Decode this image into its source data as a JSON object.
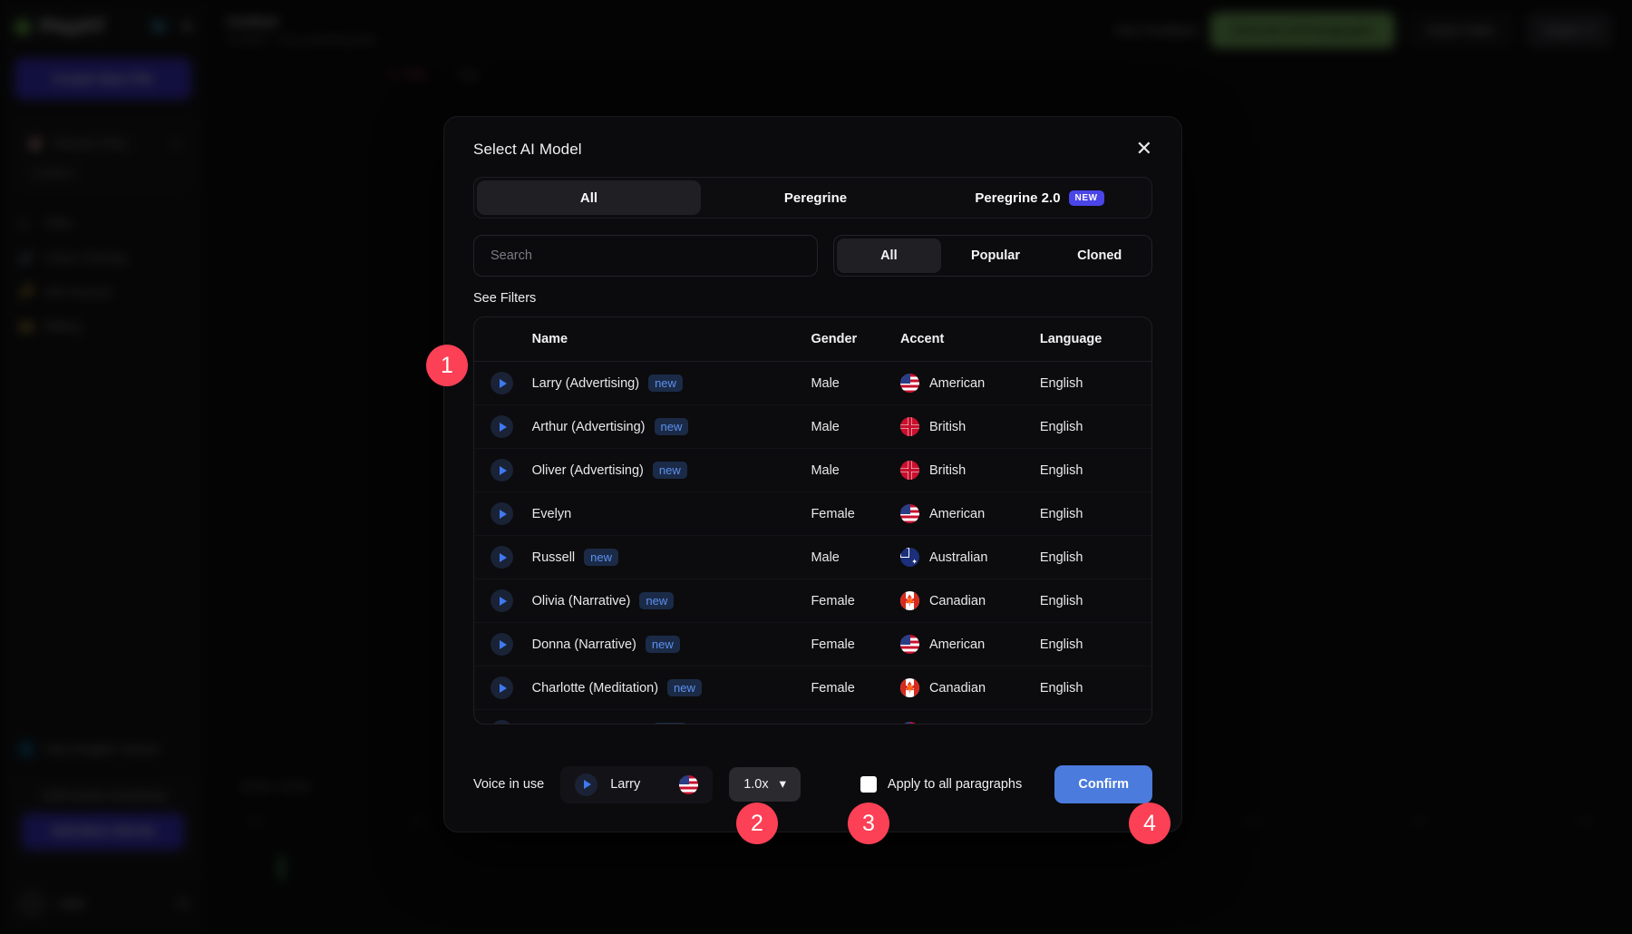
{
  "sidebar": {
    "brand": "PlayHT",
    "brand_dot": "logo-dot",
    "social": [
      "twitter-icon",
      "discord-icon"
    ],
    "new_file_label": "Create New File",
    "recent_files_label": "Recent Files",
    "recent_file_item": "Untitled",
    "nav": [
      {
        "label": "Files",
        "icon": "files-icon"
      },
      {
        "label": "Voice Cloning",
        "icon": "voice-cloning-icon"
      },
      {
        "label": "API Access",
        "icon": "api-icon"
      },
      {
        "label": "Billing",
        "icon": "billing-icon"
      }
    ],
    "non_english_label": "Non-English Voices",
    "credits_text": "1200 words remaining",
    "add_words_label": "Add More Words",
    "user_name": "User",
    "gear_icon": "gear-icon"
  },
  "topbar": {
    "doc_title": "Untitled",
    "doc_sub": "0 words · 0 sec speaking time",
    "give_feedback": "Give Feedback",
    "generate_all": "Generate All Paragraphs",
    "import_video": "Import Video",
    "export": "Export"
  },
  "edit_tabs": [
    {
      "label": "Edit",
      "active": true
    },
    {
      "label": "Title",
      "active": false
    }
  ],
  "player": {
    "time": "00:00 / 00:00",
    "controls": [
      "skip-back-icon",
      "play-icon",
      "skip-forward-icon"
    ],
    "ticks": [
      "0:00",
      "0:10",
      "0:20",
      "0:30",
      "0:40",
      "0:50",
      "1:00",
      "1:10",
      "1:20"
    ]
  },
  "modal": {
    "title": "Select AI Model",
    "close_icon": "close-icon",
    "model_tabs": [
      {
        "label": "All",
        "active": true,
        "badge": ""
      },
      {
        "label": "Peregrine",
        "active": false,
        "badge": ""
      },
      {
        "label": "Peregrine 2.0",
        "active": false,
        "badge": "NEW"
      }
    ],
    "search_placeholder": "Search",
    "search_value": "",
    "filter_tabs": [
      {
        "label": "All",
        "active": true
      },
      {
        "label": "Popular",
        "active": false
      },
      {
        "label": "Cloned",
        "active": false
      }
    ],
    "see_filters": "See Filters",
    "table": {
      "columns": [
        "",
        "Name",
        "Gender",
        "Accent",
        "Language"
      ],
      "rows": [
        {
          "play": "play-icon",
          "name": "Larry (Advertising)",
          "tag": "new",
          "gender": "Male",
          "accent": "American",
          "flag": "us",
          "language": "English"
        },
        {
          "play": "play-icon",
          "name": "Arthur (Advertising)",
          "tag": "new",
          "gender": "Male",
          "accent": "British",
          "flag": "gb",
          "language": "English"
        },
        {
          "play": "play-icon",
          "name": "Oliver (Advertising)",
          "tag": "new",
          "gender": "Male",
          "accent": "British",
          "flag": "gb",
          "language": "English"
        },
        {
          "play": "play-icon",
          "name": "Evelyn",
          "tag": "",
          "gender": "Female",
          "accent": "American",
          "flag": "us",
          "language": "English"
        },
        {
          "play": "play-icon",
          "name": "Russell",
          "tag": "new",
          "gender": "Male",
          "accent": "Australian",
          "flag": "au",
          "language": "English"
        },
        {
          "play": "play-icon",
          "name": "Olivia (Narrative)",
          "tag": "new",
          "gender": "Female",
          "accent": "Canadian",
          "flag": "ca",
          "language": "English"
        },
        {
          "play": "play-icon",
          "name": "Donna (Narrative)",
          "tag": "new",
          "gender": "Female",
          "accent": "American",
          "flag": "us",
          "language": "English"
        },
        {
          "play": "play-icon",
          "name": "Charlotte (Meditation)",
          "tag": "new",
          "gender": "Female",
          "accent": "Canadian",
          "flag": "ca",
          "language": "English"
        },
        {
          "play": "play-icon",
          "name": "Donna (Meditation)",
          "tag": "new",
          "gender": "Female",
          "accent": "American",
          "flag": "us",
          "language": "English"
        }
      ]
    },
    "footer": {
      "voice_in_use_label": "Voice in use",
      "voice_name": "Larry",
      "voice_flag": "us",
      "voice_play_icon": "play-icon",
      "speed_value": "1.0x",
      "speed_chevron": "chevron-down-icon",
      "apply_all_label": "Apply to all paragraphs",
      "apply_all_checked": false,
      "confirm_label": "Confirm"
    }
  },
  "markers": [
    {
      "n": "1"
    },
    {
      "n": "2"
    },
    {
      "n": "3"
    },
    {
      "n": "4"
    }
  ],
  "colors": {
    "accent_purple": "#3d34d8",
    "badge_new": "#4a45e8",
    "confirm_blue": "#4b7bdd",
    "marker_red": "#fc4055",
    "generate_green": "#7fbf63",
    "tag_new_text": "#5d90f0"
  }
}
